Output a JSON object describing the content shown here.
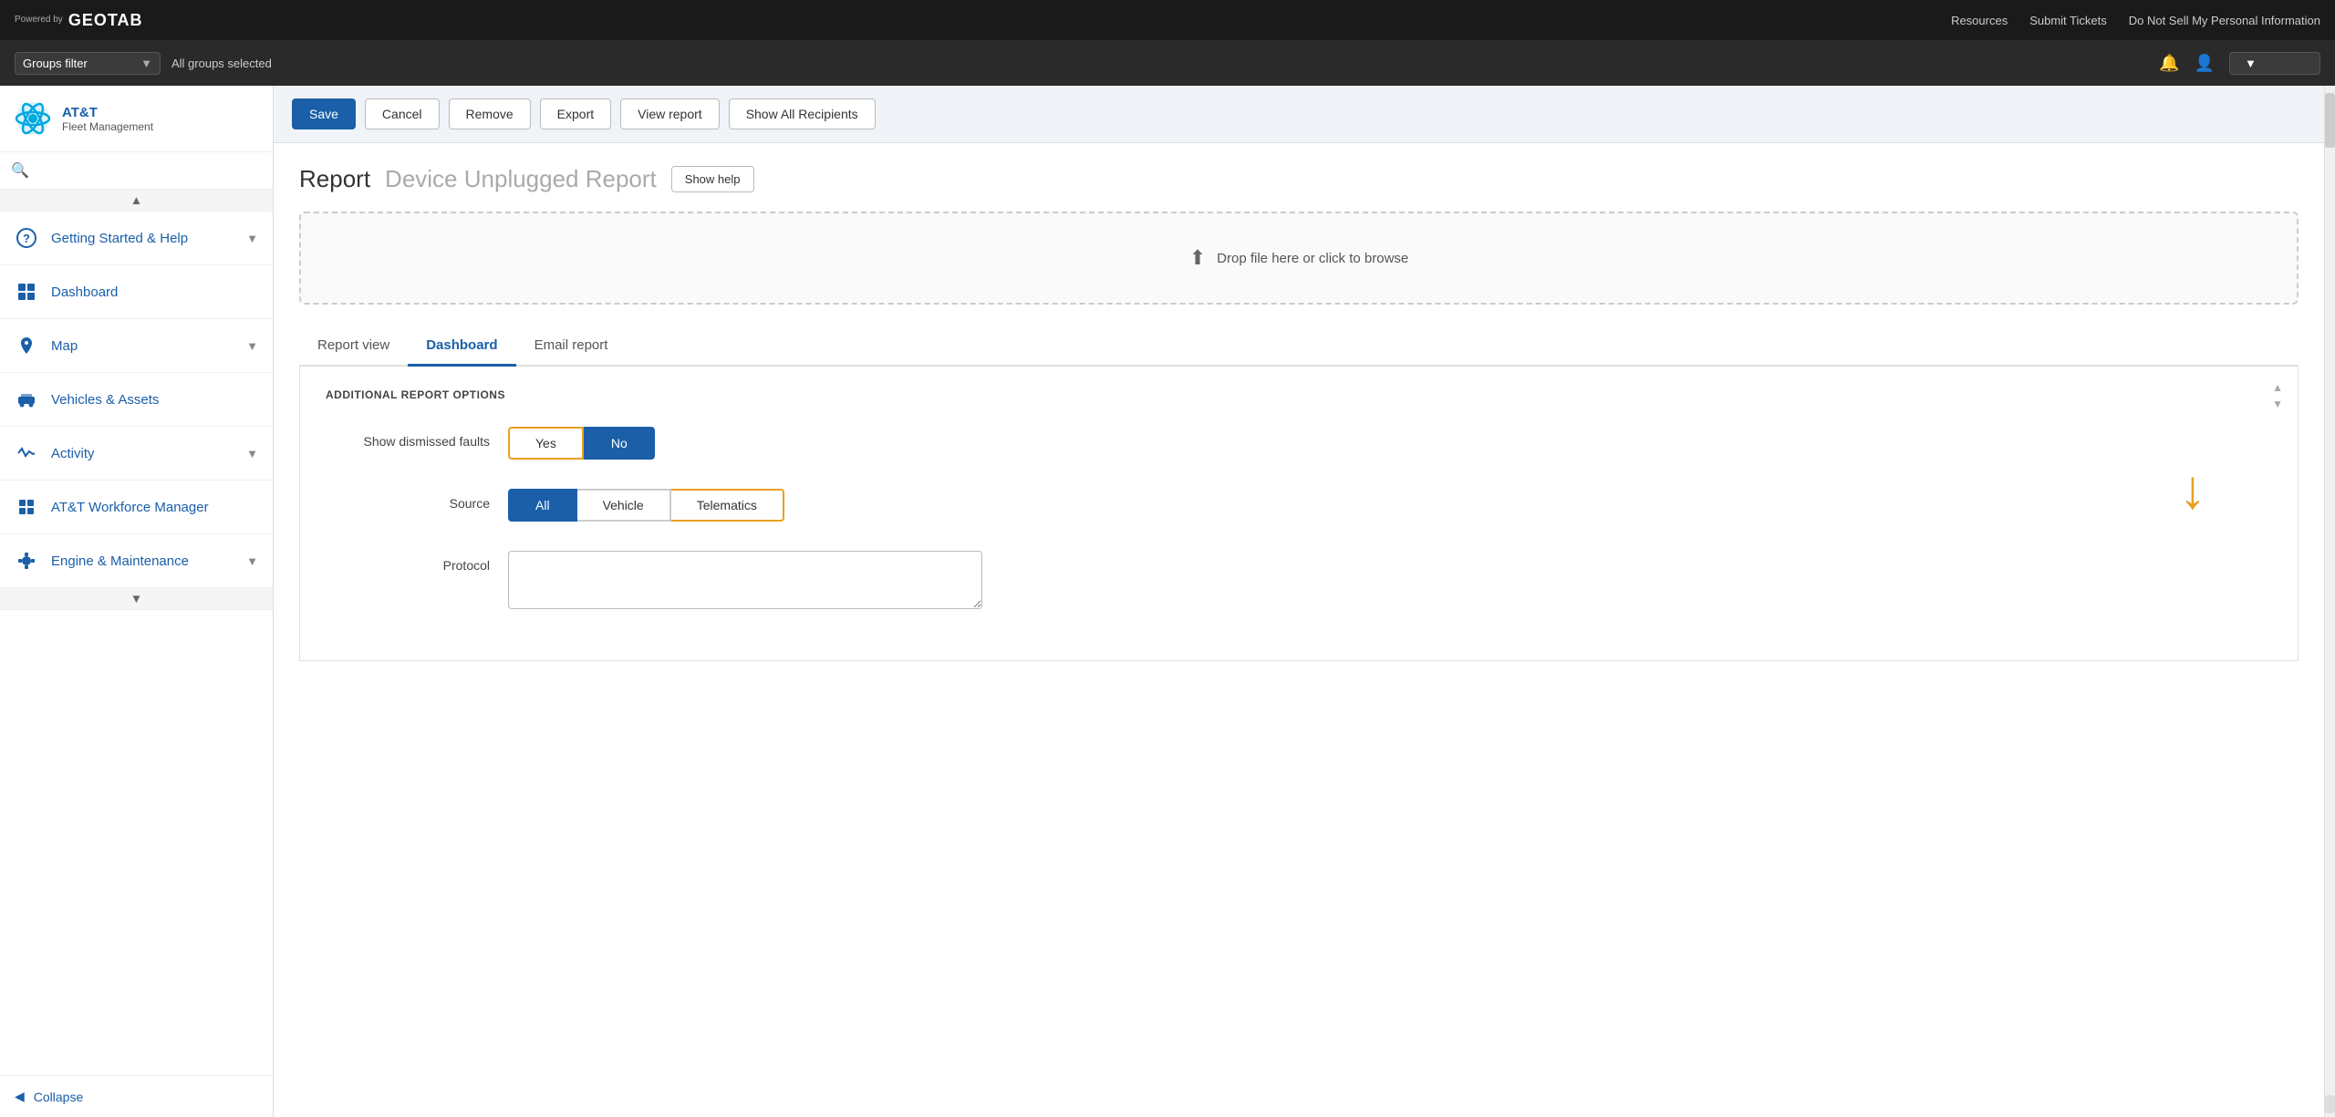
{
  "topnav": {
    "powered_by": "Powered by",
    "brand": "GEOTAB",
    "links": [
      "Resources",
      "Submit Tickets",
      "Do Not Sell My Personal Information"
    ]
  },
  "groups_bar": {
    "label": "Groups filter",
    "selected_text": "All groups selected"
  },
  "sidebar": {
    "brand_name": "AT&T",
    "brand_sub": "Fleet Management",
    "items": [
      {
        "label": "Getting Started & Help",
        "icon": "help-icon",
        "has_chevron": true
      },
      {
        "label": "Dashboard",
        "icon": "dashboard-icon",
        "has_chevron": false
      },
      {
        "label": "Map",
        "icon": "map-icon",
        "has_chevron": true
      },
      {
        "label": "Vehicles & Assets",
        "icon": "vehicles-icon",
        "has_chevron": false
      },
      {
        "label": "Activity",
        "icon": "activity-icon",
        "has_chevron": true
      },
      {
        "label": "AT&T Workforce Manager",
        "icon": "workforce-icon",
        "has_chevron": false
      },
      {
        "label": "Engine & Maintenance",
        "icon": "engine-icon",
        "has_chevron": true
      }
    ],
    "collapse_label": "Collapse"
  },
  "toolbar": {
    "save_label": "Save",
    "cancel_label": "Cancel",
    "remove_label": "Remove",
    "export_label": "Export",
    "view_report_label": "View report",
    "show_all_recipients_label": "Show All Recipients"
  },
  "report": {
    "title_label": "Report",
    "title_name": "Device Unplugged Report",
    "show_help_label": "Show help",
    "drop_zone_text": "Drop file here or click to browse"
  },
  "tabs": [
    {
      "label": "Report view",
      "active": false
    },
    {
      "label": "Dashboard",
      "active": true
    },
    {
      "label": "Email report",
      "active": false
    }
  ],
  "options": {
    "section_title": "ADDITIONAL REPORT OPTIONS",
    "show_dismissed_label": "Show dismissed faults",
    "yes_label": "Yes",
    "no_label": "No",
    "source_label": "Source",
    "all_label": "All",
    "vehicle_label": "Vehicle",
    "telematics_label": "Telematics",
    "protocol_label": "Protocol",
    "protocol_value": ""
  }
}
